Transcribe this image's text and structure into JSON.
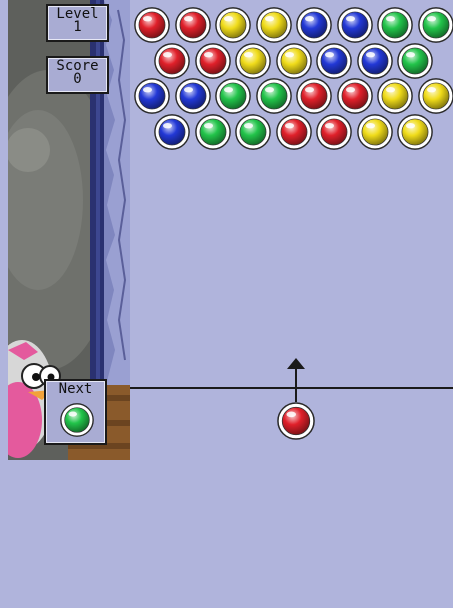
{
  "hud": {
    "level_label": "Level",
    "level_value": "1",
    "score_label": "Score",
    "score_value": "0",
    "next_label": "Next"
  },
  "colors": {
    "background": "#b0b4dc",
    "red": "#e0202a",
    "yellow": "#f0dc1a",
    "green": "#22c44a",
    "blue": "#2238d6"
  },
  "next_bubble": "green",
  "current_bubble": "red",
  "bubble_rows": [
    [
      "red",
      "red",
      "yellow",
      "yellow",
      "blue",
      "blue",
      "green",
      "green"
    ],
    [
      "red",
      "red",
      "yellow",
      "yellow",
      "blue",
      "blue",
      "green"
    ],
    [
      "blue",
      "blue",
      "green",
      "green",
      "red",
      "red",
      "yellow",
      "yellow"
    ],
    [
      "blue",
      "green",
      "green",
      "red",
      "red",
      "yellow",
      "yellow"
    ]
  ],
  "icons": {
    "aim_arrow": "arrow-up-icon",
    "mascot": "penguin-mascot"
  }
}
